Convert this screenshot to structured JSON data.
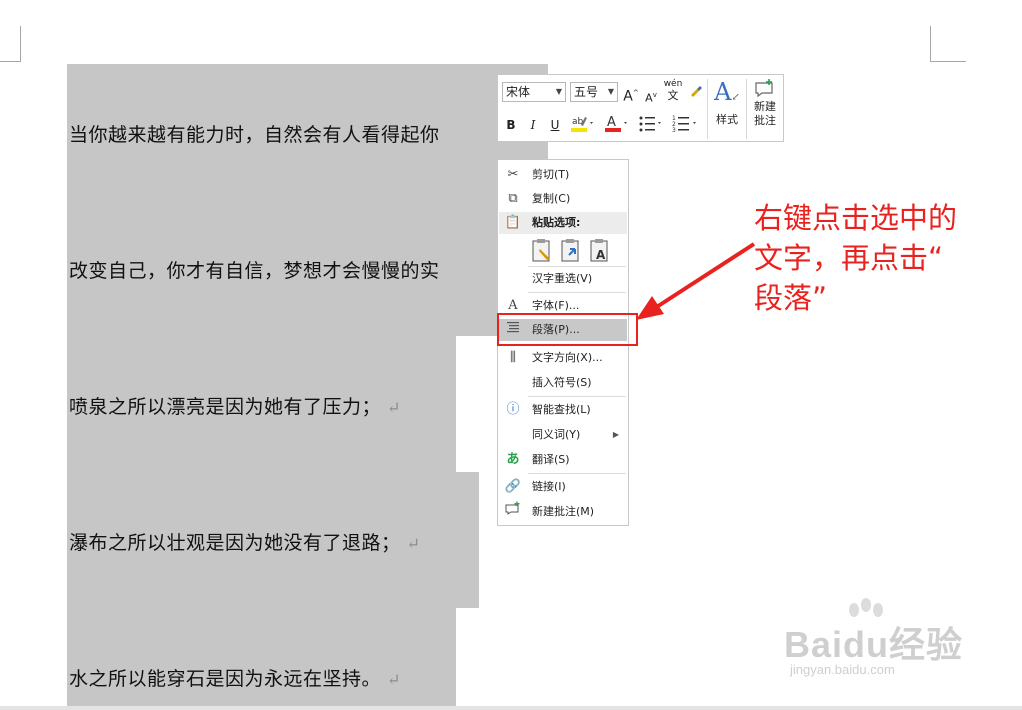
{
  "document": {
    "lines": [
      "当你越来越有能力时，自然会有人看得起你",
      "改变自己，你才有自信，梦想才会慢慢的实",
      "喷泉之所以漂亮是因为她有了压力；",
      "瀑布之所以壮观是因为她没有了退路；",
      "水之所以能穿石是因为永远在坚持。"
    ],
    "paragraph_mark": "↵"
  },
  "mini_toolbar": {
    "font_name": "宋体",
    "font_size": "五号",
    "grow_font": "A",
    "shrink_font": "A",
    "phonetic": "wén",
    "bold": "B",
    "italic": "I",
    "underline": "U",
    "font_color": "A",
    "styles_label": "样式",
    "new_comment_label_1": "新建",
    "new_comment_label_2": "批注"
  },
  "context_menu": {
    "items": [
      {
        "label": "剪切(T)",
        "icon": "scissors-icon"
      },
      {
        "label": "复制(C)",
        "icon": "copy-icon"
      },
      {
        "label": "粘贴选项:",
        "icon": "clipboard-icon"
      },
      {
        "label": "汉字重选(V)",
        "icon": ""
      },
      {
        "label": "字体(F)...",
        "icon": "font-icon"
      },
      {
        "label": "段落(P)...",
        "icon": "paragraph-icon"
      },
      {
        "label": "文字方向(X)...",
        "icon": "text-direction-icon"
      },
      {
        "label": "插入符号(S)",
        "icon": ""
      },
      {
        "label": "智能查找(L)",
        "icon": "smart-lookup-icon"
      },
      {
        "label": "同义词(Y)",
        "icon": ""
      },
      {
        "label": "翻译(S)",
        "icon": "translate-icon"
      },
      {
        "label": "链接(I)",
        "icon": "link-icon"
      },
      {
        "label": "新建批注(M)",
        "icon": "comment-icon"
      }
    ]
  },
  "annotation": {
    "line1": "右键点击选中的",
    "line2": "文字，再点击“",
    "line3": "段落”"
  },
  "watermark": {
    "logo": "Baidu经验",
    "url": "jingyan.baidu.com"
  },
  "colors": {
    "selection": "#c6c6c6",
    "annotation_red": "#e8231f",
    "highlight_yellow": "#f5e400",
    "font_color_red": "#e8231f"
  }
}
